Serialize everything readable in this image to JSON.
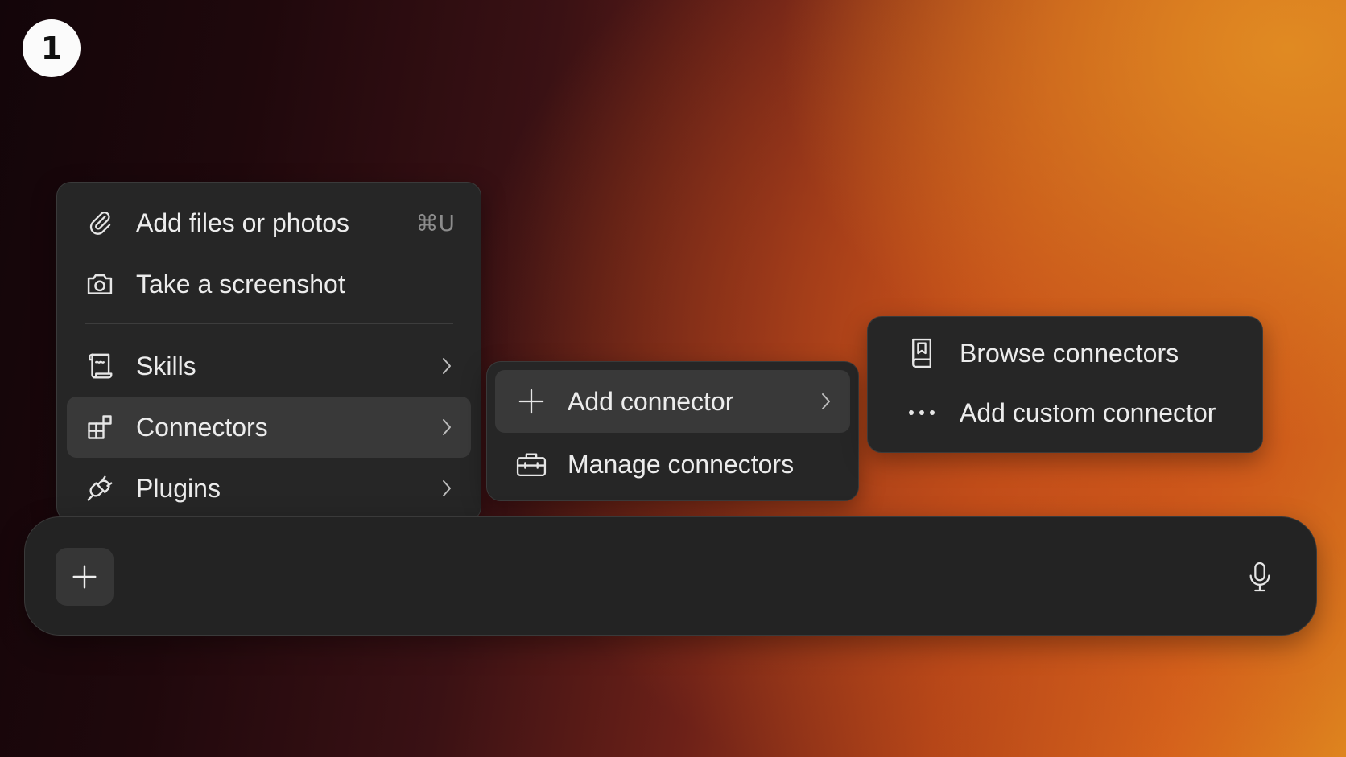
{
  "step_badge": "1",
  "attach_menu": {
    "items": [
      {
        "label": "Add files or photos",
        "icon": "paperclip-icon",
        "shortcut": "⌘U"
      },
      {
        "label": "Take a screenshot",
        "icon": "camera-icon"
      },
      {
        "label": "Skills",
        "icon": "scroll-icon",
        "has_submenu": true
      },
      {
        "label": "Connectors",
        "icon": "blocks-icon",
        "has_submenu": true,
        "active": true
      },
      {
        "label": "Plugins",
        "icon": "plug-icon",
        "has_submenu": true
      }
    ]
  },
  "connectors_submenu": {
    "items": [
      {
        "label": "Add connector",
        "icon": "plus-icon",
        "has_submenu": true,
        "active": true
      },
      {
        "label": "Manage connectors",
        "icon": "toolbox-icon"
      }
    ]
  },
  "add_connector_submenu": {
    "items": [
      {
        "label": "Browse connectors",
        "icon": "book-icon"
      },
      {
        "label": "Add custom connector",
        "icon": "ellipsis-icon"
      }
    ]
  },
  "composer": {
    "placeholder": "",
    "attach_button_icon": "plus-icon",
    "voice_button_icon": "microphone-icon"
  },
  "colors": {
    "panel_bg": "#262626",
    "active_item_bg": "#393939",
    "text": "#ececec",
    "muted_text": "#8c8c8c",
    "background_gradient": [
      "#130509",
      "#3a1114",
      "#b24418",
      "#e0891f"
    ]
  }
}
